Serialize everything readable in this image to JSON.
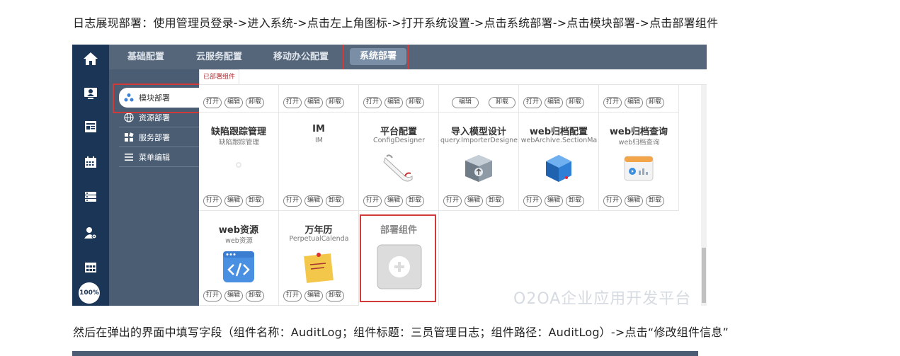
{
  "instructions": {
    "line1": "日志展现部署：使用管理员登录->进入系统->点击左上角图标->打开系统设置->点击系统部署->点击模块部署->点击部署组件",
    "line2": "然后在弹出的界面中填写字段（组件名称：AuditLog；组件标题：三员管理日志；组件路径：AuditLog）->点击“修改组件信息”"
  },
  "rail": {
    "icons": [
      "home-icon",
      "user-card-icon",
      "news-icon",
      "calendar-icon",
      "server-icon",
      "user-settings-icon",
      "grid-icon"
    ],
    "zoom": "100%"
  },
  "topbar": {
    "tabs": [
      {
        "label": "基础配置"
      },
      {
        "label": "云服务配置"
      },
      {
        "label": "移动办公配置"
      },
      {
        "label": "系统部署",
        "active": true
      }
    ]
  },
  "subnav": {
    "items": [
      {
        "label": "模块部署",
        "icon": "module-icon",
        "active": true
      },
      {
        "label": "资源部署",
        "icon": "globe-icon"
      },
      {
        "label": "服务部署",
        "icon": "blocks-icon"
      },
      {
        "label": "菜单编辑",
        "icon": "menu-icon"
      }
    ]
  },
  "content": {
    "tab": "已部署组件",
    "buttons": {
      "open": "打开",
      "edit": "编辑",
      "unload": "卸载"
    },
    "components": [
      {
        "name": "缺陷跟踪管理",
        "sub": "缺陷跟踪管理",
        "icon": "bug-icon"
      },
      {
        "name": "IM",
        "sub": "IM",
        "icon": "im-icon"
      },
      {
        "name": "平台配置",
        "sub": "ConfigDesigner",
        "icon": "scroll-icon"
      },
      {
        "name": "导入模型设计",
        "sub": "query.ImporterDesigner",
        "icon": "box-import-icon"
      },
      {
        "name": "web归档配置",
        "sub": "webArchive.SectionMa",
        "icon": "cube-icon"
      },
      {
        "name": "web归档查询",
        "sub": "web归档查询",
        "icon": "archive-chart-icon"
      },
      {
        "name": "web资源",
        "sub": "web资源",
        "icon": "code-icon"
      },
      {
        "name": "万年历",
        "sub": "PerpetualCalenda",
        "icon": "note-icon"
      },
      {
        "name": "部署组件",
        "sub": "",
        "icon": "add-icon"
      }
    ],
    "watermark": "O2OA企业应用开发平台"
  },
  "colors": {
    "rail": "#1b3557",
    "panel": "#4b5d73",
    "highlight": "#d23a3a",
    "tabText": "#b0343a"
  }
}
